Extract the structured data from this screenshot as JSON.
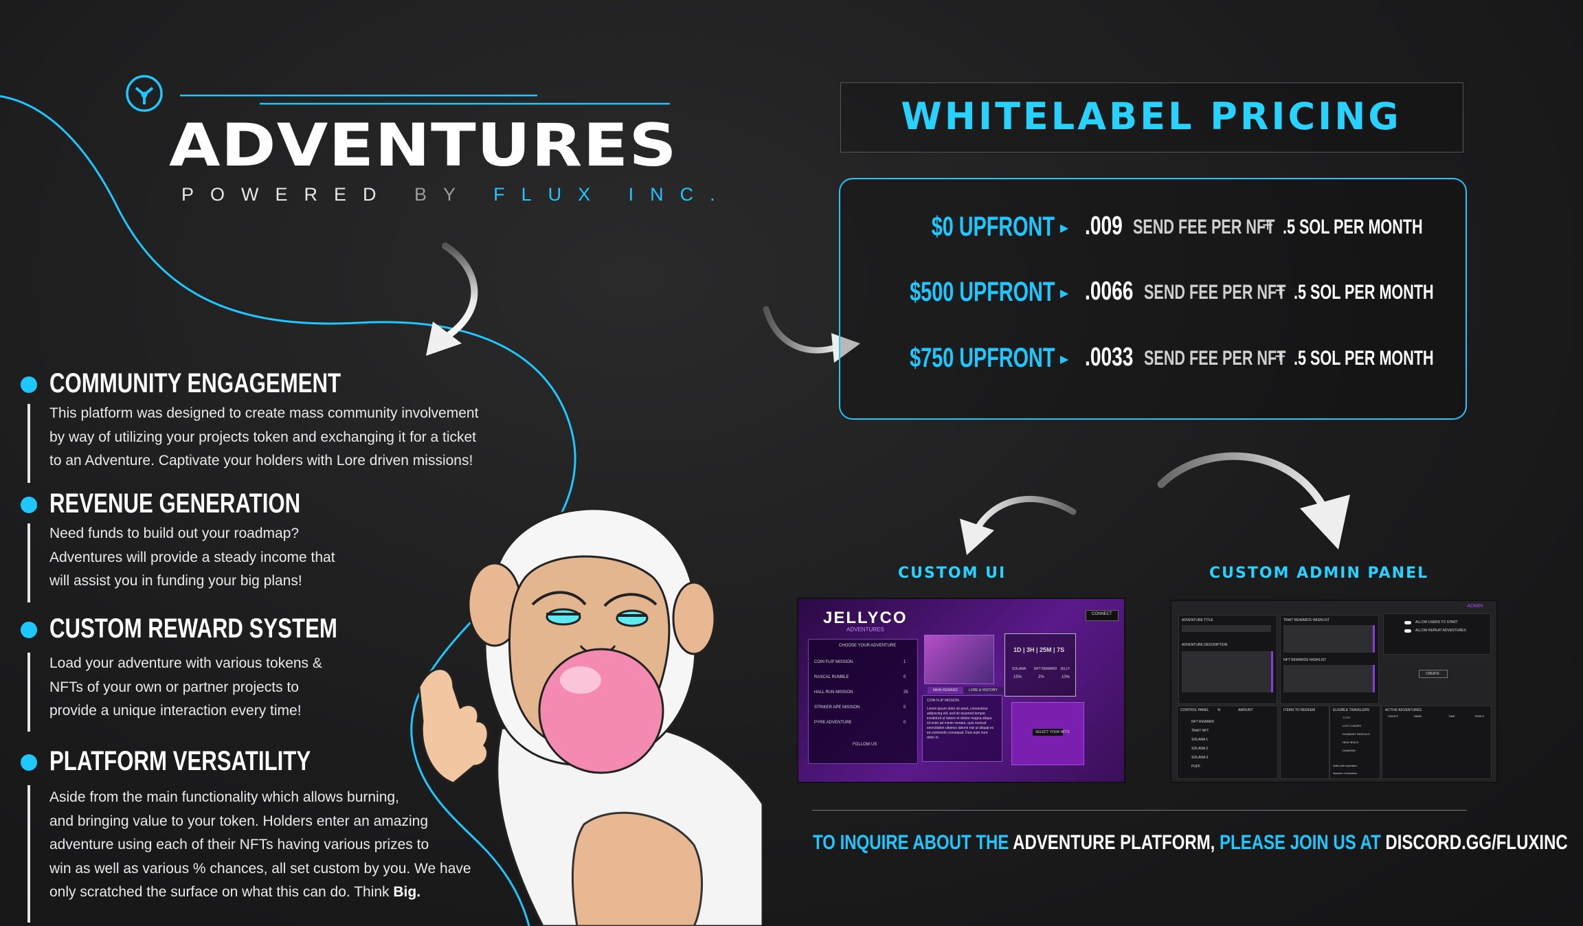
{
  "brand": {
    "title": "ADVENTURES",
    "powered": "POWERED",
    "by": "BY",
    "company": "FLUX INC.",
    "logo_icon": "flux-tripod-icon"
  },
  "features": [
    {
      "title": "COMMUNITY ENGAGEMENT",
      "body": "This platform was designed to create mass community involvement\nby way of utilizing your projects token and exchanging it for a ticket\nto an Adventure. Captivate your holders with Lore driven missions!"
    },
    {
      "title": "REVENUE GENERATION",
      "body": "Need funds to build out your roadmap?\nAdventures will provide a steady income that\nwill assist you in funding your big plans!"
    },
    {
      "title": "CUSTOM REWARD SYSTEM",
      "body": "Load your adventure with various tokens &\nNFTs of your own or partner projects to\nprovide a unique interaction every time!"
    },
    {
      "title": "PLATFORM VERSATILITY",
      "body": "Aside from the main functionality which allows burning,\nand bringing value to your token. Holders enter an amazing\nadventure using each of their NFTs having various prizes to\nwin as well as various % chances, all set custom by you. We have\nonly scratched the surface on what this can do. Think ",
      "body_bold": "Big."
    }
  ],
  "pricing": {
    "title": "WHITELABEL PRICING",
    "rows": [
      {
        "upfront": "$0 UPFRONT",
        "fee": ".009",
        "fee_label": "SEND FEE PER NFT",
        "plus": "+",
        "monthly": ".5 SOL PER MONTH"
      },
      {
        "upfront": "$500 UPFRONT",
        "fee": ".0066",
        "fee_label": "SEND FEE PER NFT",
        "plus": "+",
        "monthly": ".5 SOL PER MONTH"
      },
      {
        "upfront": "$750 UPFRONT",
        "fee": ".0033",
        "fee_label": "SEND FEE PER NFT",
        "plus": "+",
        "monthly": ".5 SOL PER MONTH"
      }
    ]
  },
  "custom_ui": {
    "label": "CUSTOM UI",
    "brand": "JELLYCO",
    "brand_sub": "ADVENTURES",
    "connect": "CONNECT",
    "choose": "CHOOSE YOUR ADVENTURE",
    "missions": [
      "COIN FLIP MISSION",
      "RASCAL RUMBLE",
      "HALL RUN MISSION",
      "STRIKER APE MISSION",
      "PYRE ADVENTURE"
    ],
    "mission_counts": [
      "1",
      "0",
      "25",
      "0",
      "0"
    ],
    "follow": "FOLLOW US",
    "timer": "1D | 3H | 25M | 7S",
    "stats_labels": [
      "SOLANA",
      "NFT REWARD",
      "JELLY"
    ],
    "stats_values": [
      "15%",
      "2%",
      "10%"
    ],
    "tabs": [
      "MAIN REWARD",
      "LORE & HISTORY"
    ],
    "desc_title": "COIN FLIP MISSION",
    "desc": "Lorem ipsum dolor sit amet, consectetur adipiscing elit, sed do eiusmod tempor incididunt ut labore et dolore magna aliqua. Ut enim ad minim veniam, quis nostrud exercitation ullamco laboris nisi ut aliquip ex ea commodo consequat. Duis aute irure dolor in.",
    "select": "SELECT YOUR NFTS"
  },
  "custom_admin": {
    "label": "CUSTOM ADMIN PANEL",
    "admin": "ADMIN",
    "adventure_title": "ADVENTURE TITLE",
    "adventure_desc": "ADVENTURE DESCRIPTION",
    "trait_rewards": "TRAIT REWARDS HASHLIST",
    "nft_rewards": "NFT REWARDS HASHLIST",
    "allow_start": "ALLOW USERS TO START",
    "allow_repeat": "ALLOW REPEAT ADVENTURES",
    "create": "CREATE",
    "control_panel": "CONTROL PANEL",
    "percent": "%",
    "amount": "AMOUNT",
    "control_items": [
      "NFT REWARD",
      "TRAIT NFT",
      "SOLANA 1",
      "SOLANA 2",
      "SOLANA 3",
      "PUFF"
    ],
    "items_redeem": "ITEMS TO REDEEM",
    "eligible": "ELIGIBLE TRAVELERS",
    "eligible_items": [
      "TYCO",
      "LOST CHIMPS",
      "RUNAWAY RASCALS",
      "NEW SEALS",
      "DIAMOND"
    ],
    "valid_until": "Valid until expiration",
    "num_travelers": "Number of travelers",
    "active": "ACTIVE ADVENTURES",
    "active_cols": [
      "ON/OFF",
      "NAME",
      "TIME",
      "TRAILS"
    ]
  },
  "footer": {
    "part1": "TO INQUIRE ABOUT THE",
    "part2": "ADVENTURE PLATFORM,",
    "part3": "PLEASE JOIN US AT",
    "part4": "DISCORD.GG/FLUXINC"
  },
  "colors": {
    "accent": "#1ec8ff",
    "background": "#1c1c1d",
    "purple": "#5a1a8a"
  }
}
